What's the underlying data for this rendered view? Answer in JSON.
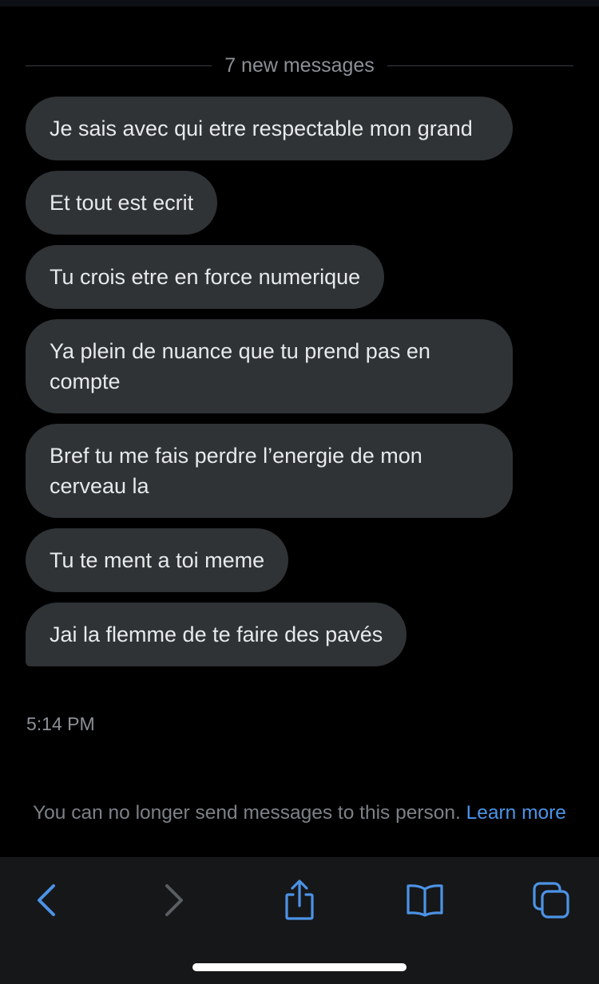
{
  "divider": {
    "label": "7 new messages"
  },
  "messages": [
    {
      "text": "Je sais avec qui etre respectable mon grand"
    },
    {
      "text": "Et tout est ecrit"
    },
    {
      "text": "Tu crois etre en force numerique"
    },
    {
      "text": "Ya plein de nuance que tu prend pas en compte"
    },
    {
      "text": "Bref tu me fais perdre l’energie de mon cerveau la"
    },
    {
      "text": "Tu te ment a toi meme"
    },
    {
      "text": "Jai la flemme de te faire des pavés"
    }
  ],
  "timestamp": "5:14 PM",
  "notice": {
    "text": "You can no longer send messages to this person.",
    "link": "Learn more"
  },
  "toolbar": {
    "back_icon": "chevron-left-icon",
    "forward_icon": "chevron-right-icon",
    "share_icon": "share-icon",
    "bookmarks_icon": "book-icon",
    "tabs_icon": "tabs-icon"
  },
  "colors": {
    "background": "#000000",
    "bubble": "#2f3336",
    "text": "#e7e9ea",
    "muted": "#8b9096",
    "accent": "#4c93e6",
    "toolbar": "#161719"
  }
}
